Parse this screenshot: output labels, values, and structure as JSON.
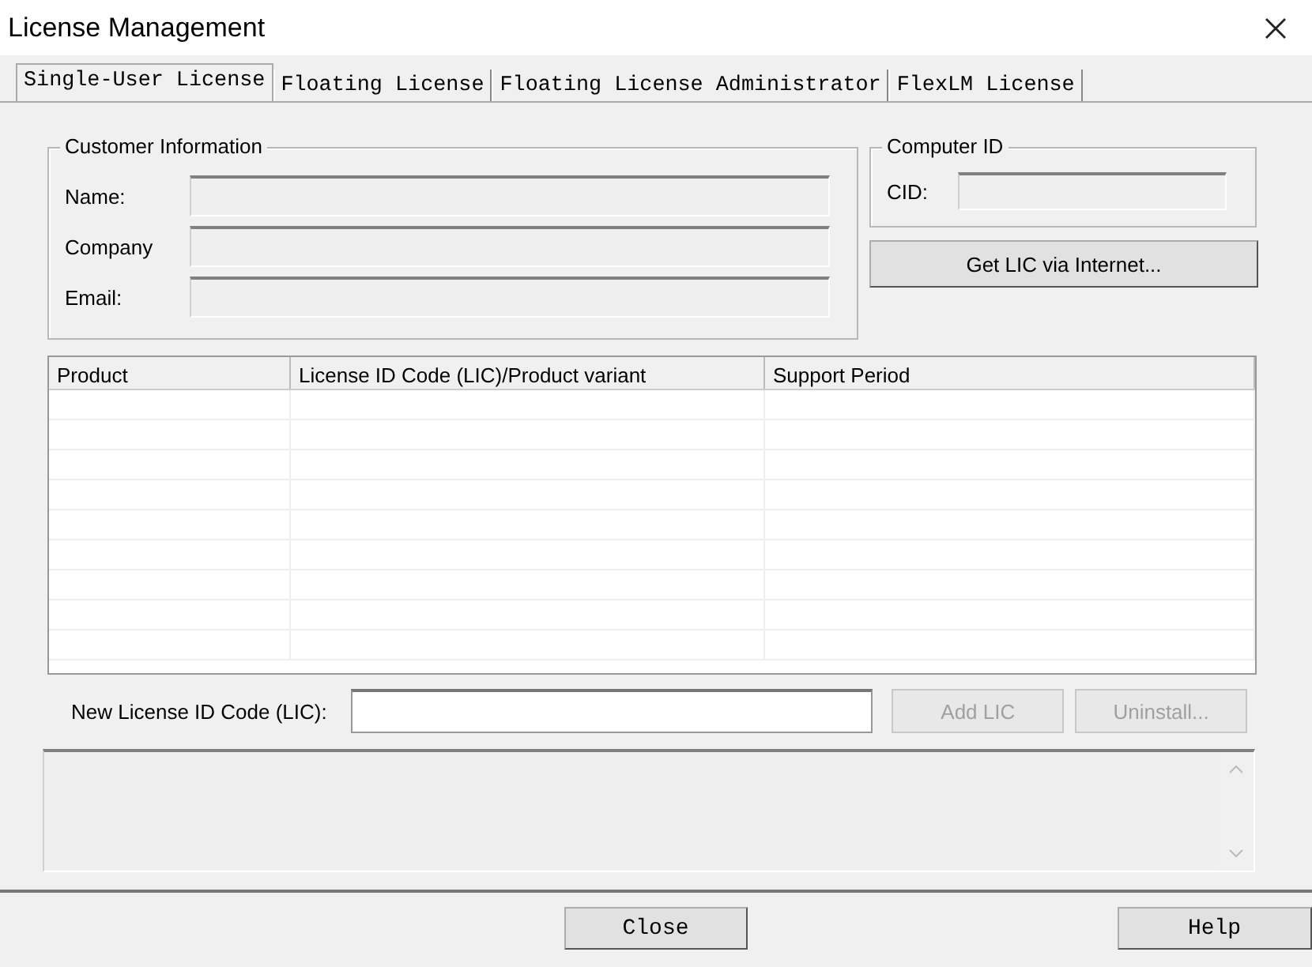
{
  "window": {
    "title": "License Management"
  },
  "tabs": [
    {
      "label": "Single-User License",
      "selected": true
    },
    {
      "label": "Floating License",
      "selected": false
    },
    {
      "label": "Floating License Administrator",
      "selected": false
    },
    {
      "label": "FlexLM License",
      "selected": false
    }
  ],
  "customer_information": {
    "title": "Customer Information",
    "fields": [
      {
        "label": "Name:"
      },
      {
        "label": "Company"
      },
      {
        "label": "Email:"
      }
    ]
  },
  "computer_id": {
    "title": "Computer ID",
    "label": "CID:",
    "button": "Get LIC via Internet..."
  },
  "table": {
    "columns": [
      "Product",
      "License ID Code (LIC)/Product variant",
      "Support Period"
    ]
  },
  "new_lic": {
    "label": "New License ID Code (LIC):",
    "buttons": [
      {
        "label": "Add LIC",
        "disabled": true
      },
      {
        "label": "Uninstall...",
        "disabled": true
      }
    ]
  },
  "footer": {
    "buttons": [
      "Close",
      "Help"
    ]
  }
}
